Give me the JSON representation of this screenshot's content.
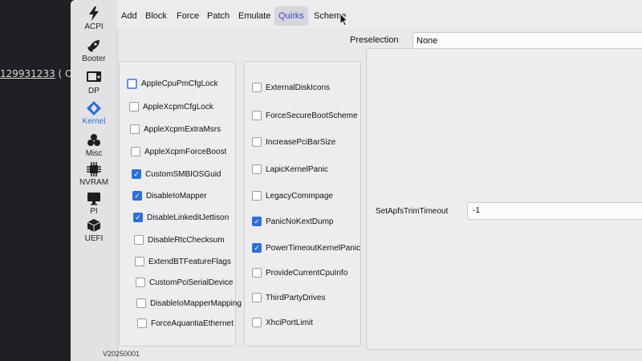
{
  "terminal": {
    "id_text": "129931233",
    "suffix_text": "( Ope"
  },
  "sidebar": {
    "items": [
      {
        "label": "ACPI",
        "icon": "lightning-icon"
      },
      {
        "label": "Booter",
        "icon": "rocket-icon"
      },
      {
        "label": "DP",
        "icon": "display-icon"
      },
      {
        "label": "Kernel",
        "icon": "kernel-icon"
      },
      {
        "label": "Misc",
        "icon": "misc-icon"
      },
      {
        "label": "NVRAM",
        "icon": "chip-icon"
      },
      {
        "label": "PI",
        "icon": "monitor-icon"
      },
      {
        "label": "UEFI",
        "icon": "box-icon"
      }
    ],
    "active": "Kernel"
  },
  "menubar": {
    "tabs": [
      "Add",
      "Block",
      "Force",
      "Patch",
      "Emulate",
      "Quirks",
      "Scheme"
    ],
    "active": "Quirks"
  },
  "preselection": {
    "label": "Preselection",
    "value": "None"
  },
  "quirks_col1": [
    {
      "label": "AppleCpuPmCfgLock",
      "checked": false
    },
    {
      "label": "AppleXcpmCfgLock",
      "checked": false
    },
    {
      "label": "AppleXcpmExtraMsrs",
      "checked": false
    },
    {
      "label": "AppleXcpmForceBoost",
      "checked": false
    },
    {
      "label": "CustomSMBIOSGuid",
      "checked": true
    },
    {
      "label": "DisableIoMapper",
      "checked": true
    },
    {
      "label": "DisableLinkeditJettison",
      "checked": true
    },
    {
      "label": "DisableRtcChecksum",
      "checked": false
    },
    {
      "label": "ExtendBTFeatureFlags",
      "checked": false
    },
    {
      "label": "CustomPciSerialDevice",
      "checked": false
    },
    {
      "label": "DisableIoMapperMapping",
      "checked": false
    },
    {
      "label": "ForceAquantiaEthernet",
      "checked": false
    }
  ],
  "quirks_col2": [
    {
      "label": "ExternalDiskIcons",
      "checked": false
    },
    {
      "label": "ForceSecureBootScheme",
      "checked": false
    },
    {
      "label": "IncreasePciBarSize",
      "checked": false
    },
    {
      "label": "LapicKernelPanic",
      "checked": false
    },
    {
      "label": "LegacyCommpage",
      "checked": false
    },
    {
      "label": "PanicNoKextDump",
      "checked": true
    },
    {
      "label": "PowerTimeoutKernelPanic",
      "checked": true
    },
    {
      "label": "ProvideCurrentCpuInfo",
      "checked": false
    },
    {
      "label": "ThirdPartyDrives",
      "checked": false
    },
    {
      "label": "XhciPortLimit",
      "checked": false
    }
  ],
  "settings": {
    "label": "SetApfsTrimTimeout",
    "value": "-1"
  },
  "version": "V20250001",
  "colors": {
    "accent": "#2f6fd6",
    "active_tab_text": "#3a47c8"
  }
}
